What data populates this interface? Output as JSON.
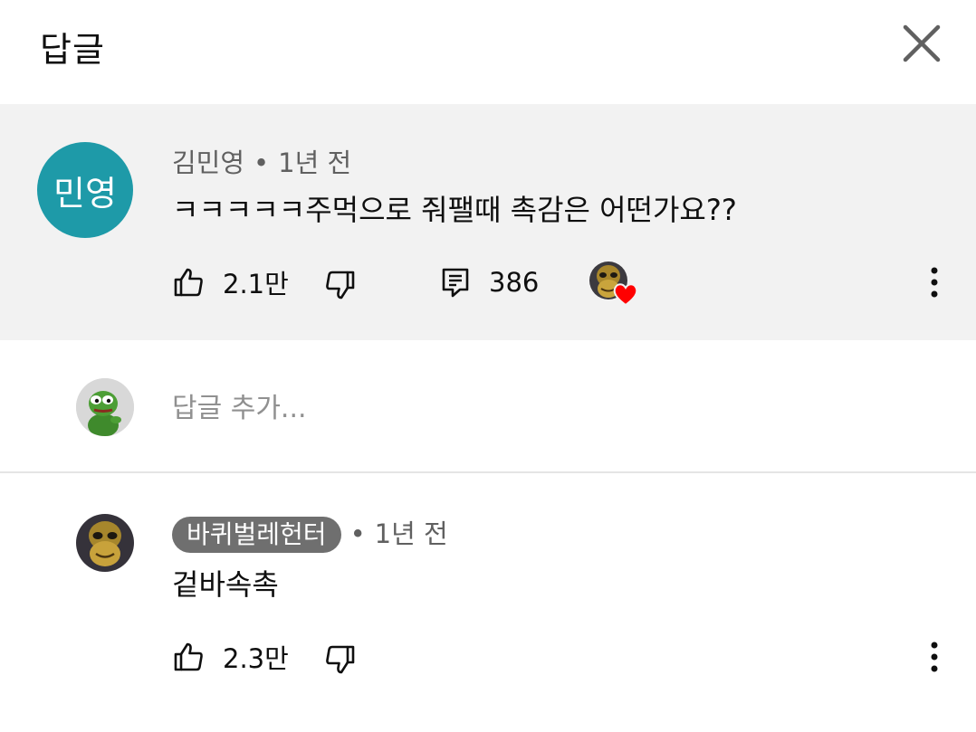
{
  "header": {
    "title": "답글",
    "close_icon": "close-icon"
  },
  "top_comment": {
    "avatar_initials": "민영",
    "avatar_color": "#1e9aa8",
    "author": "김민영",
    "separator": "•",
    "time": "1년 전",
    "text": "ㅋㅋㅋㅋㅋ주먹으로 줘팰때 촉감은 어떤가요??",
    "like_count": "2.1만",
    "reply_count": "386",
    "heart_color": "#ff0000"
  },
  "add_reply": {
    "placeholder": "답글 추가..."
  },
  "reply": {
    "author": "바퀴벌레헌터",
    "separator": "•",
    "time": "1년 전",
    "text": "겉바속촉",
    "like_count": "2.3만"
  }
}
